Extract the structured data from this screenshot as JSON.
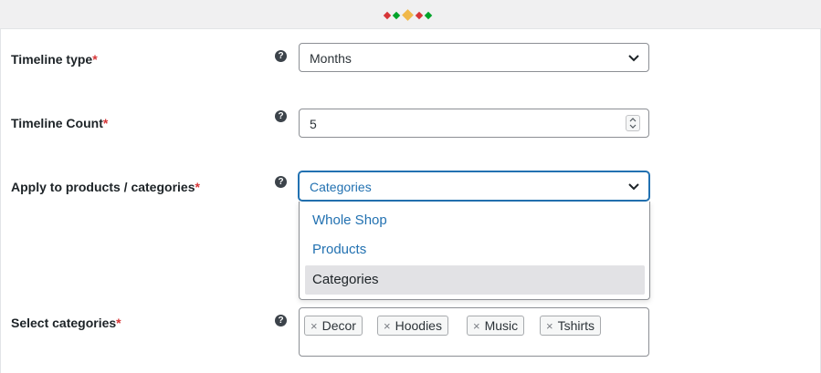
{
  "header": {
    "dot_colors": [
      "#d63638",
      "#00a32a",
      "#f0b849",
      "#d63638",
      "#00a32a"
    ]
  },
  "form": {
    "timeline_type": {
      "label": "Timeline type",
      "required_mark": "*",
      "help": "?",
      "value": "Months"
    },
    "timeline_count": {
      "label": "Timeline Count",
      "required_mark": "*",
      "help": "?",
      "value": "5"
    },
    "apply_to": {
      "label": "Apply to products / categories",
      "required_mark": "*",
      "help": "?",
      "value": "Categories",
      "options": [
        "Whole Shop",
        "Products",
        "Categories"
      ],
      "selected_option": "Categories"
    },
    "select_categories": {
      "label": "Select categories",
      "required_mark": "*",
      "help": "?",
      "tags": [
        "Decor",
        "Hoodies",
        "Music",
        "Tshirts"
      ],
      "remove_glyph": "×"
    }
  },
  "colors": {
    "accent": "#2271b1",
    "required": "#d63638",
    "selected_bg": "#e2e2e5"
  }
}
